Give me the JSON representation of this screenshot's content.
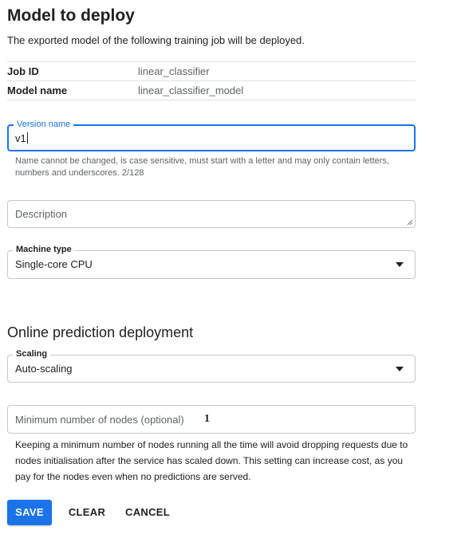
{
  "section_model": {
    "title": "Model to deploy",
    "intro": "The exported model of the following training job will be deployed."
  },
  "details": [
    {
      "label": "Job ID",
      "value": "linear_classifier"
    },
    {
      "label": "Model name",
      "value": "linear_classifier_model"
    }
  ],
  "version_name": {
    "label": "Version name",
    "value": "v1",
    "hint": "Name cannot be changed, is case sensitive, must start with a letter and may only contain letters, numbers and underscores. 2/128"
  },
  "description": {
    "placeholder": "Description"
  },
  "machine_type": {
    "label": "Machine type",
    "selected": "Single-core CPU"
  },
  "section_online": {
    "title": "Online prediction deployment"
  },
  "scaling": {
    "label": "Scaling",
    "selected": "Auto-scaling"
  },
  "min_nodes": {
    "placeholder": "Minimum number of nodes (optional)",
    "value": "1",
    "help": "Keeping a minimum number of nodes running all the time will avoid dropping requests due to nodes initialisation after the service has scaled down. This setting can increase cost, as you pay for the nodes even when no predictions are served."
  },
  "actions": {
    "save": "SAVE",
    "clear": "CLEAR",
    "cancel": "CANCEL"
  },
  "colors": {
    "accent": "#1a73e8",
    "text": "#202124",
    "muted": "#5f6368"
  }
}
